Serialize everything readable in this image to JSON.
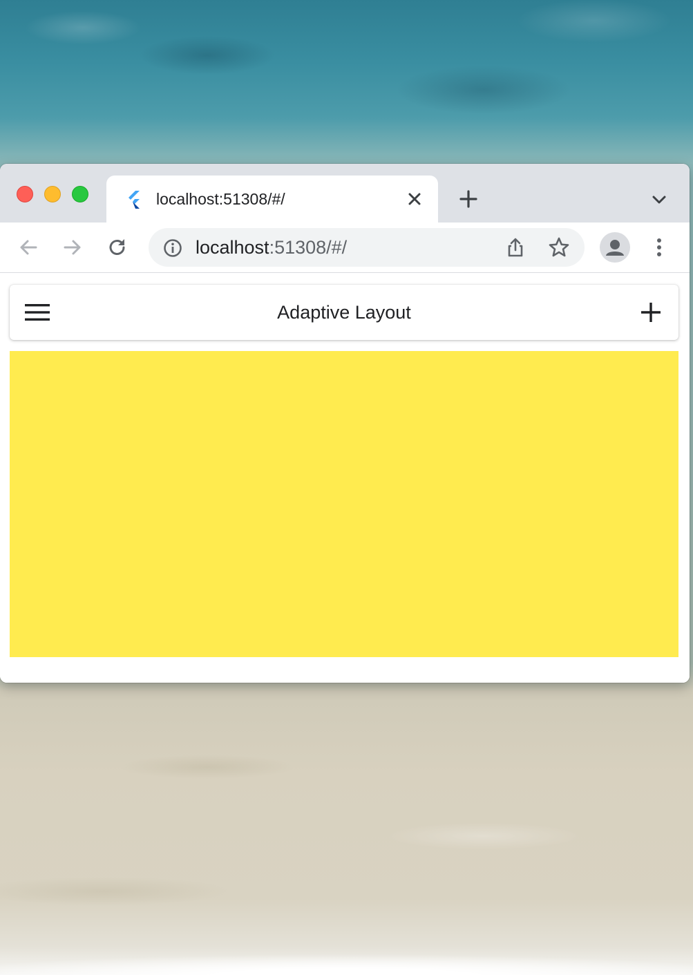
{
  "browser": {
    "tab": {
      "title": "localhost:51308/#/",
      "favicon": "flutter-logo-icon"
    },
    "address_bar": {
      "host": "localhost",
      "rest": ":51308/#/"
    },
    "toolbar_icons": [
      "back-arrow-icon",
      "forward-arrow-icon",
      "reload-icon",
      "info-icon",
      "share-icon",
      "star-icon",
      "profile-avatar-icon",
      "more-menu-icon"
    ]
  },
  "app": {
    "title": "Adaptive Layout",
    "menu_icon": "hamburger-menu-icon",
    "add_icon": "plus-icon"
  },
  "colors": {
    "content_panel": "#ffeb4f",
    "appbar": "#ffffff",
    "tab_strip": "#dee1e6",
    "traffic_close": "#fe5f57",
    "traffic_minimize": "#febc2e",
    "traffic_zoom": "#28c840"
  }
}
